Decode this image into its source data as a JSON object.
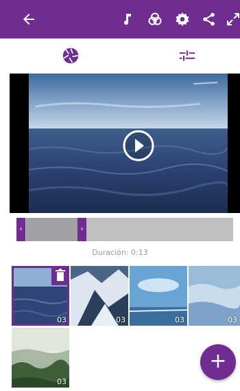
{
  "colors": {
    "accent": "#6f2c91",
    "timeline_track": "#c0c0c2",
    "timeline_selection": "#a2a2a6",
    "duration_text": "#9a9a9a"
  },
  "toolbar": {
    "icons": [
      "back-arrow-icon",
      "music-note-icon",
      "filter-icon",
      "gear-icon",
      "share-icon",
      "expand-icon"
    ]
  },
  "tabs": [
    {
      "icon": "aperture-icon",
      "selected": true
    },
    {
      "icon": "adjustments-icon",
      "selected": false
    }
  ],
  "preview": {
    "icon": "play-icon"
  },
  "timeline": {
    "left_handle_glyph": "‹",
    "right_handle_glyph": "›",
    "selection_start_fraction": 0.05,
    "selection_end_fraction": 0.3
  },
  "duration_label": "Duración: 0:13",
  "clips": [
    {
      "duration": "03",
      "selected": true,
      "scene": "sea"
    },
    {
      "duration": "03",
      "selected": false,
      "scene": "snowy-mountain"
    },
    {
      "duration": "03",
      "selected": false,
      "scene": "beach-sky"
    },
    {
      "duration": "03",
      "selected": false,
      "scene": "icy-water"
    },
    {
      "duration": "03",
      "selected": false,
      "scene": "forest-islands"
    }
  ],
  "fab": {
    "label": "+"
  }
}
